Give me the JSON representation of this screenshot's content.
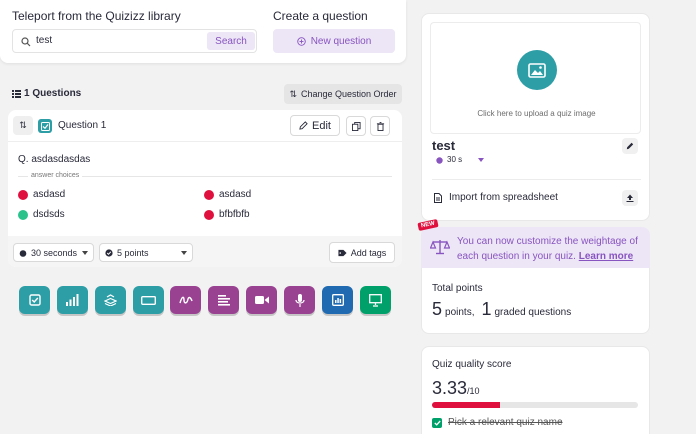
{
  "library": {
    "title": "Teleport from the Quizizz library",
    "search_value": "test",
    "search_button": "Search"
  },
  "create": {
    "title": "Create a question",
    "new_question_button": "New question"
  },
  "questions": {
    "count_label": "1 Questions",
    "change_order_button": "Change Question Order"
  },
  "question": {
    "label": "Question 1",
    "edit_button": "Edit",
    "text": "Q. asdasdasdas",
    "answer_choices_label": "answer choices",
    "answers": [
      {
        "text": "asdasd",
        "status": "incorrect",
        "color": "#e0103e"
      },
      {
        "text": "asdasd",
        "status": "incorrect",
        "color": "#e0103e"
      },
      {
        "text": "dsdsds",
        "status": "correct",
        "color": "#2bc28c"
      },
      {
        "text": "bfbfbfb",
        "status": "incorrect",
        "color": "#e0103e"
      }
    ],
    "time_select": "30 seconds",
    "points_select": "5 points",
    "add_tags_button": "Add tags"
  },
  "question_types": [
    {
      "name": "multiple-choice",
      "icon": "checkbox-icon",
      "color": "#2d9da6"
    },
    {
      "name": "poll",
      "icon": "bar-chart-icon",
      "color": "#2d9da6"
    },
    {
      "name": "reorder",
      "icon": "stack-icon",
      "color": "#2d9da6"
    },
    {
      "name": "fill-in-blank",
      "icon": "blank-box-icon",
      "color": "#2d9da6"
    },
    {
      "name": "draw",
      "icon": "draw-icon",
      "color": "#9a4292"
    },
    {
      "name": "open-ended",
      "icon": "text-lines-icon",
      "color": "#9a4292"
    },
    {
      "name": "video-response",
      "icon": "video-icon",
      "color": "#9a4292"
    },
    {
      "name": "audio-response",
      "icon": "microphone-icon",
      "color": "#9a4292"
    },
    {
      "name": "slide",
      "icon": "slide-icon",
      "color": "#1f6ab0"
    },
    {
      "name": "interactive-slide",
      "icon": "presentation-icon",
      "color": "#00a06a"
    }
  ],
  "quiz": {
    "upload_text": "Click here to upload a quiz image",
    "name": "test",
    "time": "30 s",
    "import_label": "Import from spreadsheet"
  },
  "promo": {
    "badge": "NEW",
    "text_before_link": "You can now customize the weightage of each question in your quiz. ",
    "link": "Learn more"
  },
  "totals": {
    "title": "Total points",
    "points_value": "5",
    "points_unit": "points,",
    "graded_value": "1",
    "graded_unit": "graded questions"
  },
  "quality": {
    "title": "Quiz quality score",
    "score": "3.33",
    "score_denominator": "/10",
    "progress": 0.33,
    "checklist_item": "Pick a relevant quiz name"
  },
  "colors": {
    "accent_purple": "#8854c0",
    "light_purple": "#ede6f6",
    "teal": "#2d9da6",
    "red": "#e0103e"
  }
}
